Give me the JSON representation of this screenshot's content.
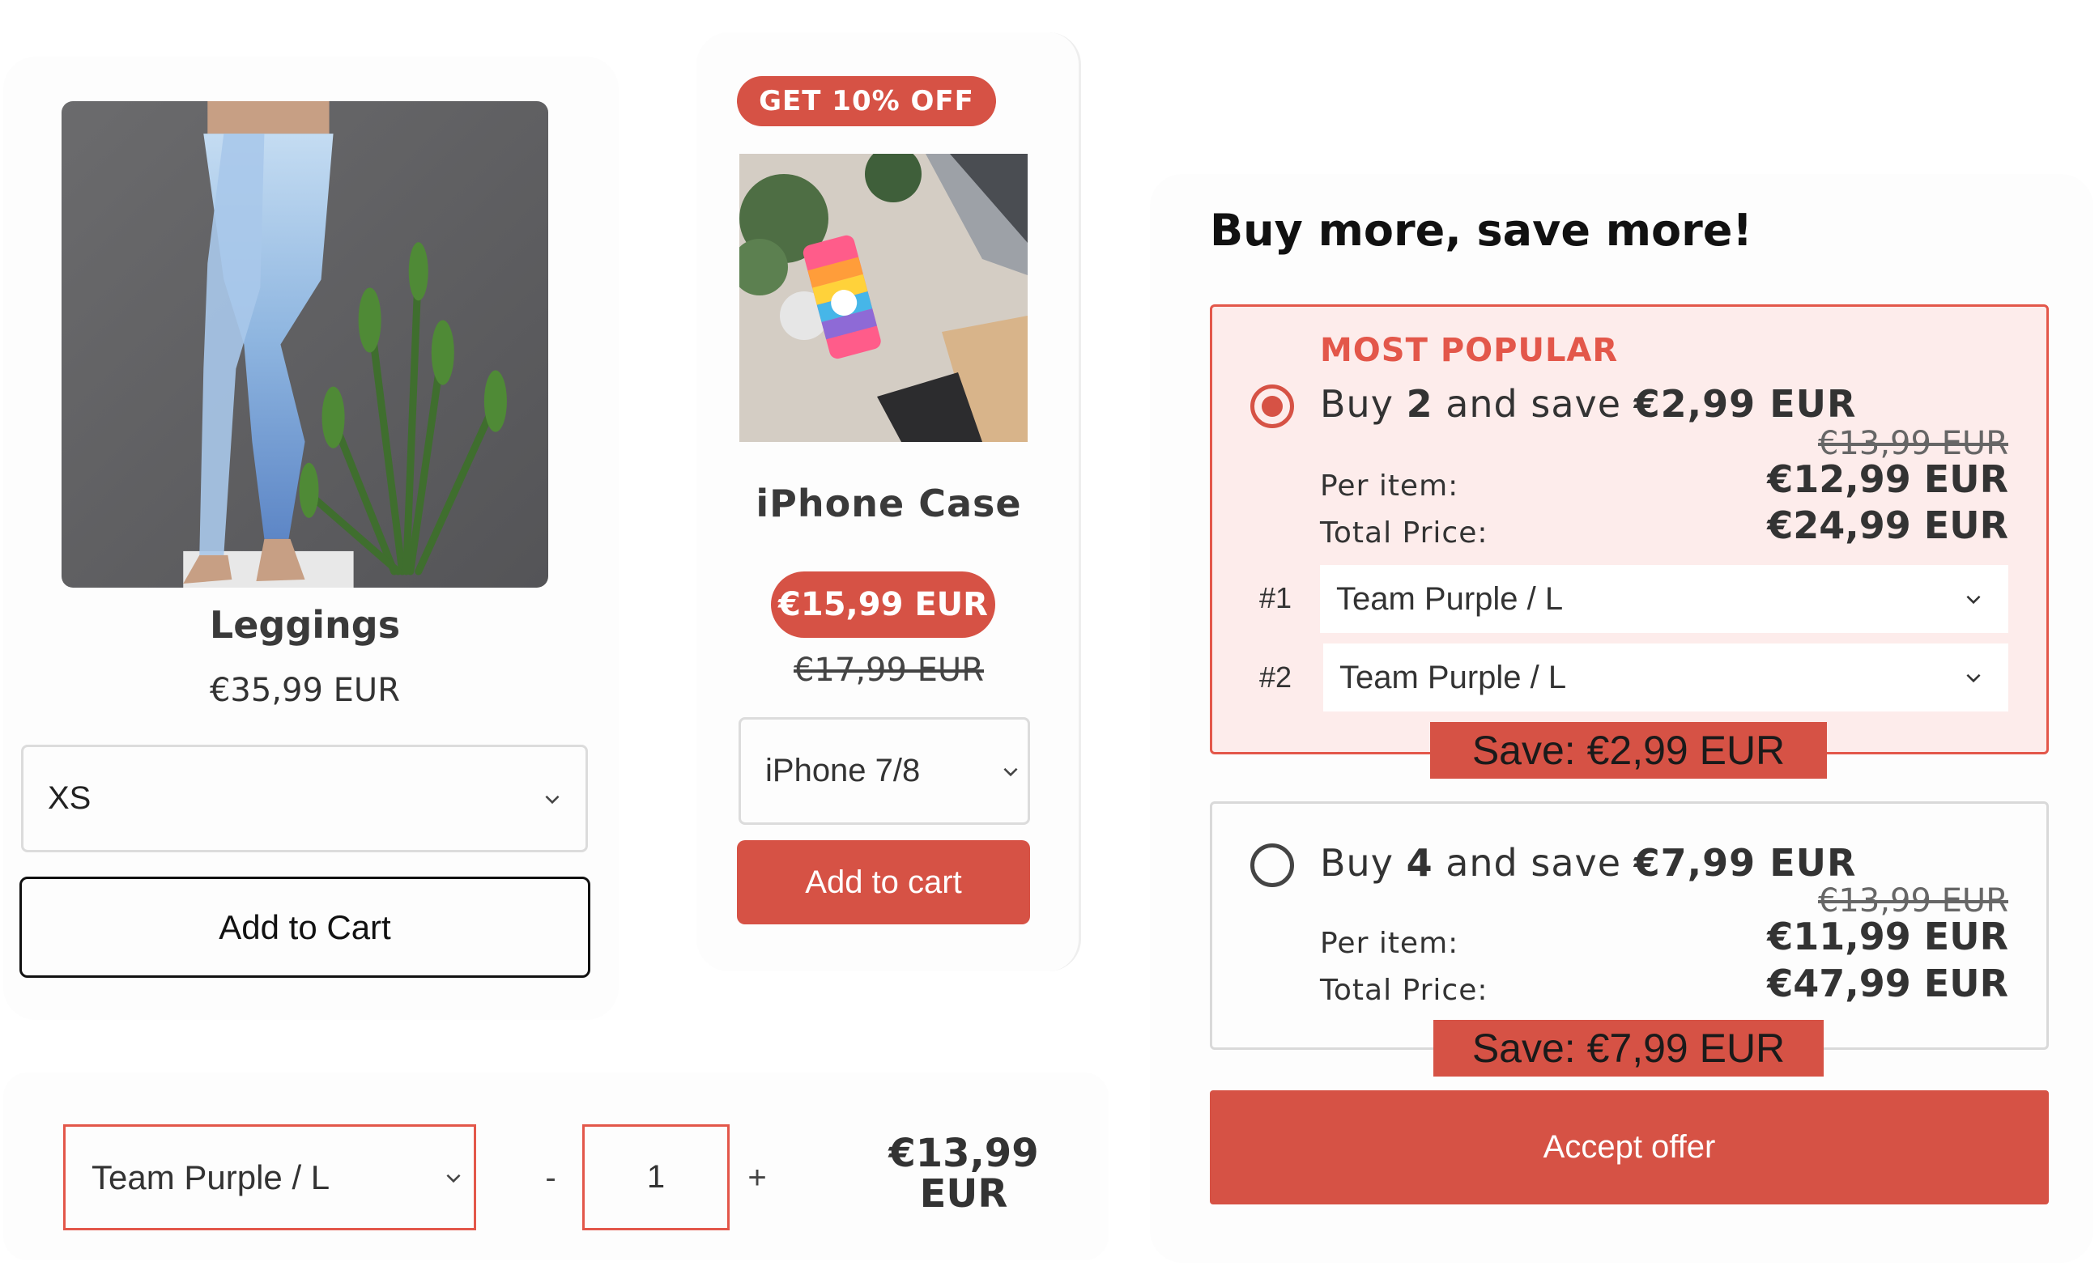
{
  "leggings": {
    "title": "Leggings",
    "price": "€35,99 EUR",
    "size_value": "XS",
    "add_label": "Add to Cart",
    "image_icon": "leggings-photo"
  },
  "iphone_case": {
    "badge": "GET 10% OFF",
    "title": "iPhone Case",
    "sale_price": "€15,99 EUR",
    "original_price": "€17,99 EUR",
    "model_value": "iPhone 7/8",
    "add_label": "Add to cart",
    "image_icon": "phone-case-photo"
  },
  "bottom_bar": {
    "variant_value": "Team Purple / L",
    "minus_label": "-",
    "quantity": "1",
    "plus_label": "+",
    "price_line1": "€13,99",
    "price_line2": "EUR"
  },
  "bundle": {
    "heading": "Buy more, save more!",
    "offers": [
      {
        "badge": "MOST POPULAR",
        "buy_prefix": "Buy ",
        "qty": "2",
        "save_text": " and save ",
        "save_amount": "€2,99 EUR",
        "compare_price": "€13,99 EUR",
        "per_item_label": "Per item:",
        "per_item_price": "€12,99 EUR",
        "total_label": "Total Price:",
        "total_price": "€24,99 EUR",
        "selected": true,
        "variants": [
          {
            "index": "#1",
            "value": "Team Purple / L"
          },
          {
            "index": "#2",
            "value": "Team Purple / L"
          }
        ],
        "save_tag": "Save: €2,99 EUR"
      },
      {
        "buy_prefix": "Buy ",
        "qty": "4",
        "save_text": " and save ",
        "save_amount": "€7,99 EUR",
        "compare_price": "€13,99 EUR",
        "per_item_label": "Per item:",
        "per_item_price": "€11,99 EUR",
        "total_label": "Total Price:",
        "total_price": "€47,99 EUR",
        "selected": false,
        "save_tag": "Save: €7,99 EUR"
      }
    ],
    "accept_label": "Accept offer"
  },
  "colors": {
    "accent": "#d65245",
    "active_bg": "#fdeceb",
    "active_border": "#e3574a"
  }
}
